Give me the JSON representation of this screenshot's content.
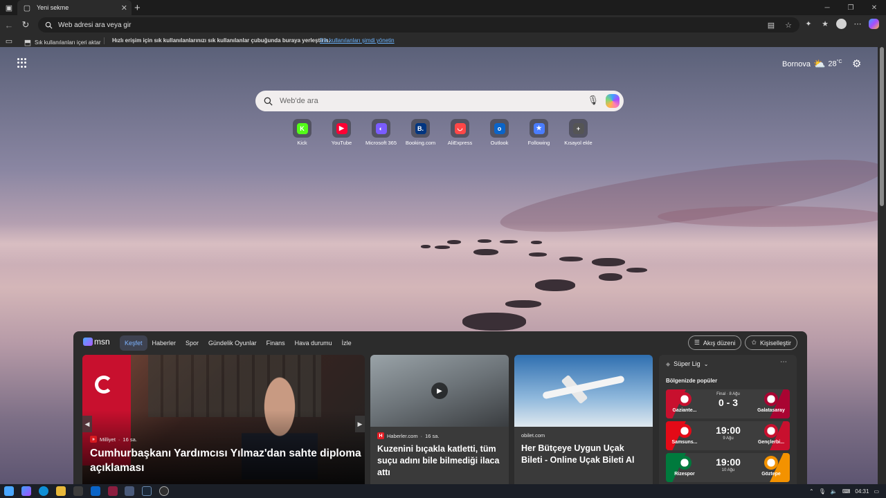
{
  "browser": {
    "tab_title": "Yeni sekme",
    "address_placeholder": "Web adresi ara veya gir"
  },
  "favorites_bar": {
    "import_label": "Sık kullanılanları içeri aktar",
    "hint": "Hızlı erişim için sık kullanılanlarınızı sık kullanılanlar çubuğunda buraya yerleştirin.",
    "manage_link": "Sık kullanılanları şimdi yönetin"
  },
  "weather": {
    "location": "Bornova",
    "temperature": "28",
    "unit": "°C"
  },
  "search": {
    "placeholder": "Web'de ara"
  },
  "quick_links": [
    {
      "label": "Kick",
      "color": "#53fc18",
      "glyph": "K"
    },
    {
      "label": "YouTube",
      "color": "#ff0033",
      "glyph": "▶"
    },
    {
      "label": "Microsoft 365",
      "color": "#7a5cff",
      "glyph": "◐"
    },
    {
      "label": "Booking.com",
      "color": "#003580",
      "glyph": "B."
    },
    {
      "label": "AliExpress",
      "color": "#ff4747",
      "glyph": "◡"
    },
    {
      "label": "Outlook",
      "color": "#0a64c8",
      "glyph": "o"
    },
    {
      "label": "Following",
      "color": "#4a7dff",
      "glyph": "★"
    },
    {
      "label": "Kısayol ekle",
      "color": "#555555",
      "glyph": "+"
    }
  ],
  "msn": {
    "brand": "msn",
    "tabs": [
      "Keşfet",
      "Haberler",
      "Spor",
      "Gündelik Oyunlar",
      "Finans",
      "Hava durumu",
      "İzle"
    ],
    "actions": {
      "feed_layout": "Akış düzeni",
      "personalize": "Kişiselleştir"
    }
  },
  "hero": {
    "source": "Milliyet",
    "time": "16 sa.",
    "title": "Cumhurbaşkanı Yardımcısı Yılmaz'dan sahte diploma açıklaması"
  },
  "cards": [
    {
      "source": "Haberler.com",
      "time": "16 sa.",
      "title": "Kuzenini bıçakla katletti, tüm suçu adını bile bilmediği ilaca attı"
    },
    {
      "source": "obilet.com",
      "time": "",
      "title": "Her Bütçeye Uygun Uçak Bileti - Online Uçak Bileti Al"
    }
  ],
  "sports": {
    "league": "Süper Lig",
    "subtitle": "Bölgenizde popüler",
    "matches": [
      {
        "home": "Gaziante...",
        "away": "Galatasaray",
        "status": "Final · 8 Ağu",
        "score": "0 - 3",
        "date": "",
        "home_color": "#c8102e",
        "away_color": "#a90432"
      },
      {
        "home": "Samsuns...",
        "away": "Gençlerbi...",
        "status": "",
        "score": "19:00",
        "date": "9 Ağu",
        "home_color": "#e30a17",
        "away_color": "#c8102e"
      },
      {
        "home": "Rizespor",
        "away": "Göztepe",
        "status": "",
        "score": "19:00",
        "date": "10 Ağu",
        "home_color": "#007a3d",
        "away_color": "#f39200"
      }
    ]
  },
  "taskbar": {
    "time": "04:31"
  }
}
